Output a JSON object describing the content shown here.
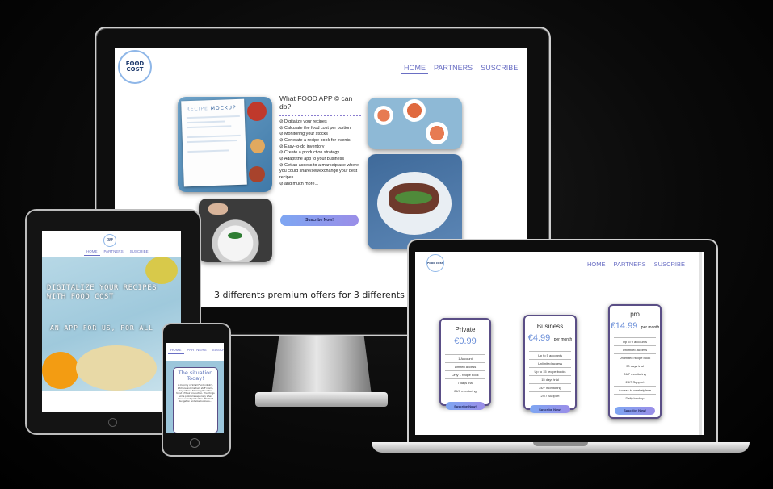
{
  "colors": {
    "accent": "#6a6fc4",
    "button_start": "#7ea6f2",
    "button_end": "#9a8ee8",
    "price": "#6a8ed8"
  },
  "brand": {
    "logo_text": "FOOD COST"
  },
  "nav": {
    "items": [
      "HOME",
      "PARTNERS",
      "SUSCRIBE"
    ]
  },
  "desktop": {
    "heading": "What FOOD APP © can do?",
    "features": [
      "Digitalize your recipes",
      "Calculate the food cost per portion",
      "Monitoring your stocks",
      "Generate a recipe book for events",
      "Easy-to-do inventory",
      "Create a production strategy",
      "Adapt the app to your business",
      "Get an access to a marketplace where you could share/sell/exchange your best recipes",
      "and much more..."
    ],
    "subscribe_button": "Suscribe Now!",
    "offers_text": "3 differents premium offers for 3 differents serv",
    "mockup_card": {
      "title_left": "RECIPE",
      "title_right": "MOCKUP"
    }
  },
  "tablet": {
    "hero_title": "DIGITALIZE YOUR RECIPES WITH FOOD COST",
    "hero_subtitle": "AN APP FOR US, FOR ALL"
  },
  "phone": {
    "card_title": "The situation Today!",
    "card_text": "A majority of Small Food industry, kitchens and medium staff rooms, stay without following the latest trend of their production. The things some problems especially when about a food production. The food budget on and slow business..."
  },
  "laptop": {
    "plans": [
      {
        "name": "Private",
        "price": "€0.99",
        "period": "",
        "features": [
          "1 Account",
          "Limited access",
          "Only 1 recipe book",
          "7 days trial",
          "24/7 monitoring"
        ],
        "button": "Suscribe Now!"
      },
      {
        "name": "Business",
        "price": "€4.99",
        "period": "per month",
        "features": [
          "Up to 5 accounts",
          "Unlimited access",
          "Up to 15 recipe books",
          "15 days trial",
          "24/7 monitoring",
          "24/7 Support"
        ],
        "button": "Suscribe Now!"
      },
      {
        "name": "pro",
        "price": "€14.99",
        "period": "per month",
        "features": [
          "Up to 9 accounts",
          "Unlimited access",
          "Unlimited recipe book",
          "30 days trial",
          "24/7 monitoring",
          "24/7 Support",
          "Access to marketplace",
          "Daily backup"
        ],
        "button": "Suscribe Now!"
      }
    ]
  }
}
